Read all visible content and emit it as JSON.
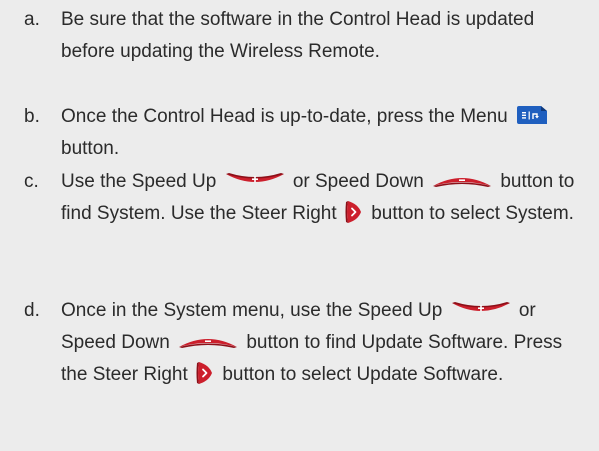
{
  "steps": [
    {
      "marker": "a.",
      "parts": {
        "t1": "Be sure that the software in the Control Head is updated before updating the Wireless Remote."
      }
    },
    {
      "marker": "b.",
      "parts": {
        "t1": "Once the Control Head is up-to-date, press the Menu",
        "t2": "button."
      }
    },
    {
      "marker": "c.",
      "parts": {
        "t1": "Use the Speed Up",
        "t2": "or Speed Down",
        "t3": "button to find System. Use the Steer Right",
        "t4": "button to select System."
      }
    },
    {
      "marker": "d.",
      "parts": {
        "t1": "Once in the System menu, use the Speed Up",
        "t2": "or Speed Down",
        "t3": "button to find Update Software. Press the Steer Right",
        "t4": "button to select Update Software."
      }
    }
  ],
  "icons": {
    "menu": "menu-button-icon",
    "speed_up": "speed-up-button-icon",
    "speed_down": "speed-down-button-icon",
    "steer_right": "steer-right-button-icon"
  },
  "colors": {
    "background": "#ececec",
    "text": "#2b2b2b",
    "menu_blue": "#1f5fbf",
    "button_red": "#cc1f2c"
  }
}
